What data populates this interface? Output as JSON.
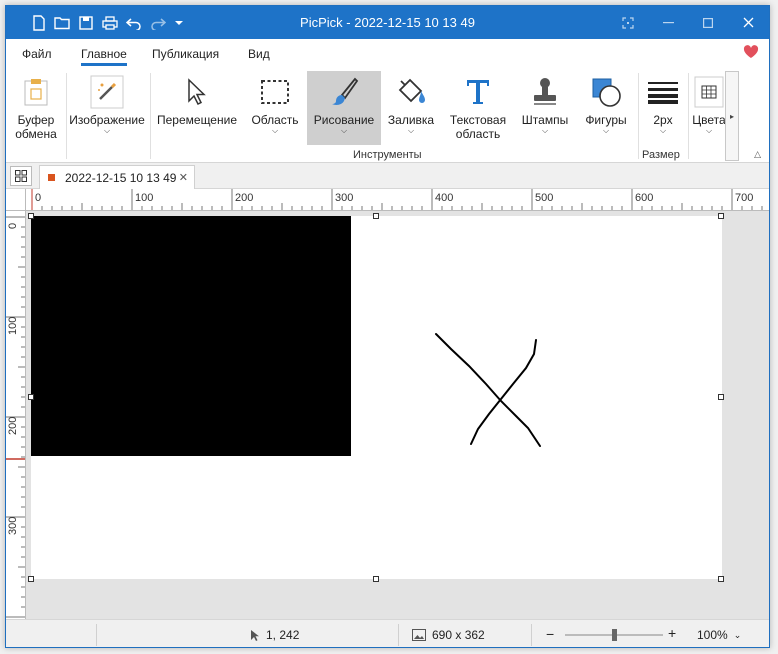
{
  "window": {
    "title": "PicPick - 2022-12-15 10 13 49"
  },
  "menu": {
    "tabs": [
      "Файл",
      "Главное",
      "Публикация",
      "Вид"
    ],
    "active": "Главное"
  },
  "ribbon": {
    "buttons": {
      "clipboard": "Буфер обмена",
      "image": "Изображение",
      "move": "Перемещение",
      "area": "Область",
      "draw": "Рисование",
      "fill": "Заливка",
      "text": "Текстовая область",
      "stamps": "Штампы",
      "shapes": "Фигуры",
      "size": "2px",
      "colors": "Цвета"
    },
    "groups": {
      "tools": "Инструменты",
      "size": "Размер"
    }
  },
  "document_tab": {
    "name": "2022-12-15 10 13 49"
  },
  "rulers": {
    "horizontal": [
      "0",
      "100",
      "200",
      "300",
      "400",
      "500",
      "600",
      "700"
    ],
    "vertical": [
      "0",
      "100",
      "200",
      "300"
    ]
  },
  "status": {
    "cursor": "1, 242",
    "image_size": "690 x 362",
    "zoom": "100%",
    "zoom_level": 0.5
  },
  "colors": {
    "accent": "#1e73c8",
    "heart": "#e2505c",
    "tab_marker": "#d9541e"
  }
}
